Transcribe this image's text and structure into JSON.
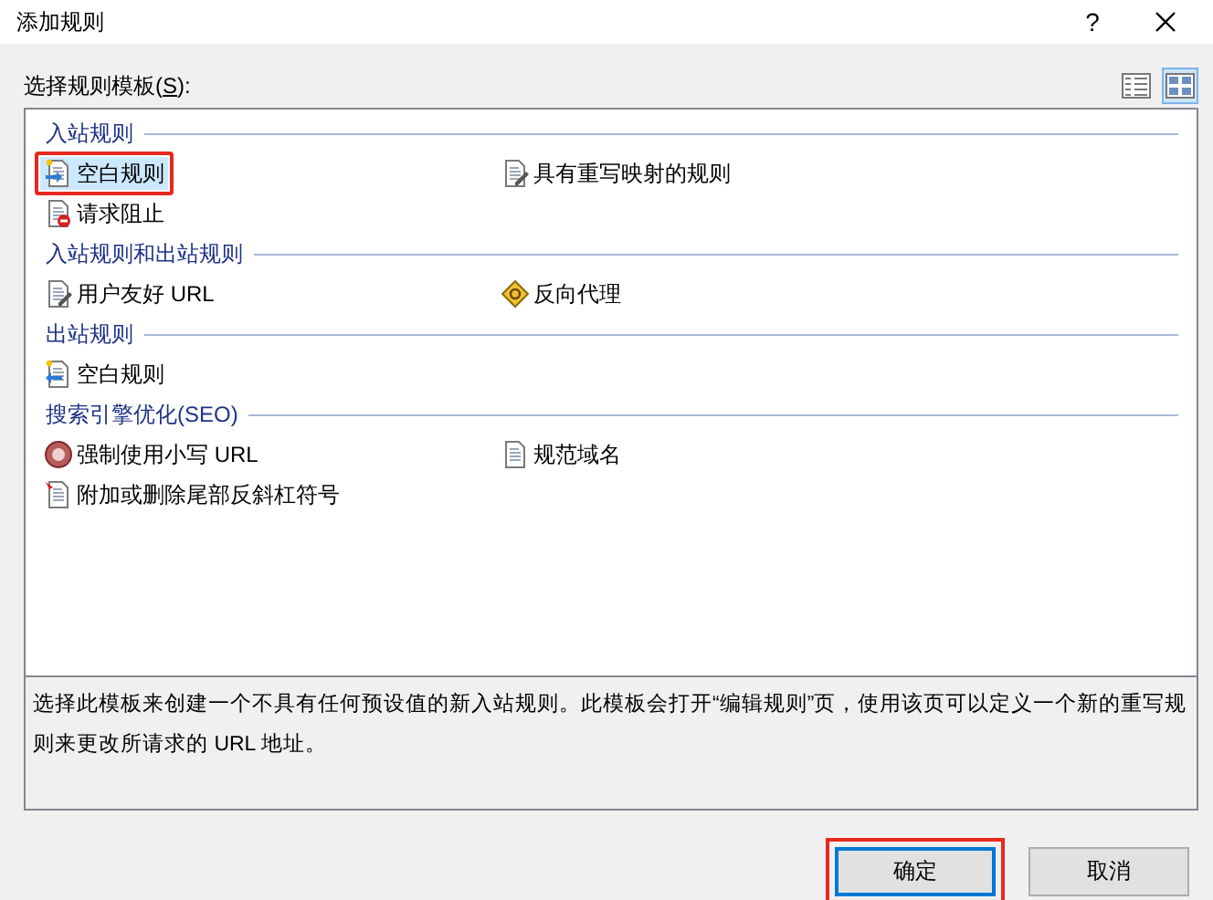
{
  "window": {
    "title": "添加规则",
    "help": "?"
  },
  "template_label": {
    "before": "选择规则模板(",
    "mnemonic": "S",
    "after": "):"
  },
  "views": [
    {
      "kind": "details",
      "selected": false
    },
    {
      "kind": "tiles",
      "selected": true
    }
  ],
  "groups": [
    {
      "title": "入站规则",
      "items": [
        {
          "label": "空白规则",
          "kind": "blank-in",
          "selected": true,
          "annotated": true
        },
        {
          "label": "具有重写映射的规则",
          "kind": "rewrite-map",
          "selected": false,
          "annotated": false
        },
        {
          "label": "请求阻止",
          "kind": "block",
          "selected": false,
          "annotated": false
        }
      ]
    },
    {
      "title": "入站规则和出站规则",
      "items": [
        {
          "label": "用户友好 URL",
          "kind": "friendly-url",
          "selected": false,
          "annotated": false
        },
        {
          "label": "反向代理",
          "kind": "reverse-proxy",
          "selected": false,
          "annotated": false
        }
      ]
    },
    {
      "title": "出站规则",
      "items": [
        {
          "label": "空白规则",
          "kind": "blank-out",
          "selected": false,
          "annotated": false
        }
      ]
    },
    {
      "title": "搜索引擎优化(SEO)",
      "items": [
        {
          "label": "强制使用小写 URL",
          "kind": "lowercase",
          "selected": false,
          "annotated": false
        },
        {
          "label": "规范域名",
          "kind": "canonical",
          "selected": false,
          "annotated": false
        },
        {
          "label": "附加或删除尾部反斜杠符号",
          "kind": "slash",
          "selected": false,
          "annotated": false
        }
      ]
    }
  ],
  "description": "选择此模板来创建一个不具有任何预设值的新入站规则。此模板会打开“编辑规则”页，使用该页可以定义一个新的重写规则来更改所请求的 URL 地址。",
  "buttons": [
    {
      "label": "确定",
      "default": true,
      "annotated": true
    },
    {
      "label": "取消",
      "default": false,
      "annotated": false
    }
  ]
}
